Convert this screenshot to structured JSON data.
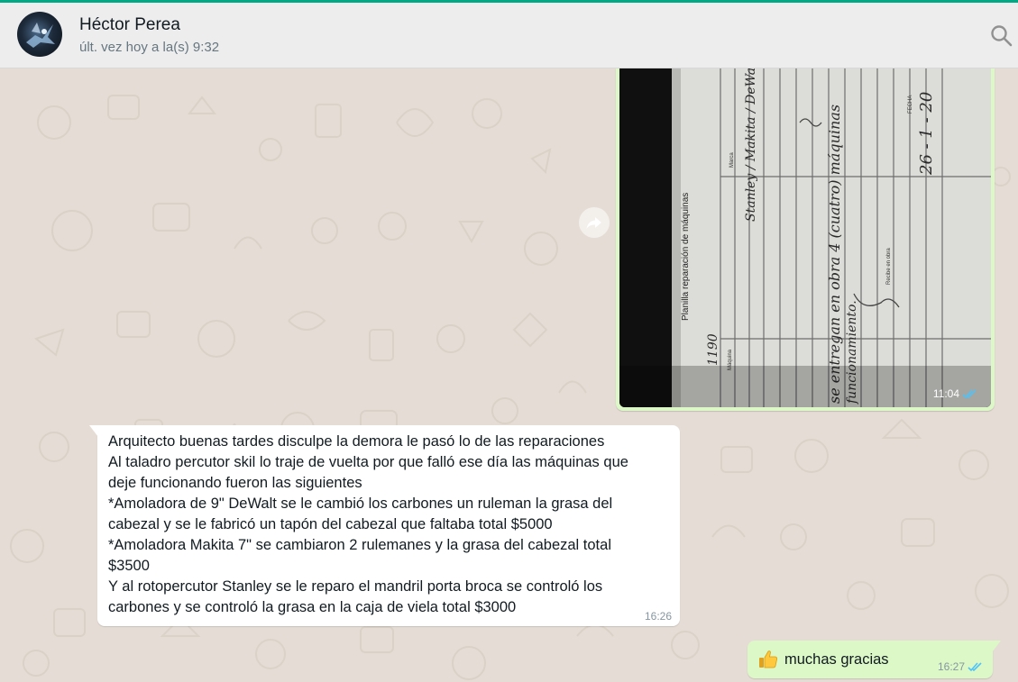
{
  "header": {
    "contact_name": "Héctor Perea",
    "last_seen": "últ. vez hoy a la(s) 9:32",
    "search_icon": "search-icon"
  },
  "messages": [
    {
      "type": "image",
      "direction": "outgoing",
      "time": "11:04",
      "read": true,
      "photo_text": {
        "title": "Planilla reparación de máquinas",
        "col_marca": "Marca",
        "col_fecha": "FECHA",
        "col_maquina": "Máquina",
        "col_recibe": "Recibe en obra",
        "hw_brands": "Stanley / Makita / DeWalt",
        "hw_date": "26 - 1 - 20",
        "hw_note": "se entregan en obra 4 (cuatro) máquinas",
        "hw_note2": "funcionamiento.",
        "hw_number": "1190"
      }
    },
    {
      "type": "text",
      "direction": "incoming",
      "time": "16:26",
      "lines": [
        "Arquitecto buenas tardes disculpe la demora le pasó lo de las reparaciones",
        "Al taladro percutor skil lo traje de vuelta por que falló ese día las máquinas que",
        "deje funcionando fueron las siguientes",
        "*Amoladora de 9\" DeWalt se le cambió los carbones un ruleman la grasa del",
        "cabezal y se le fabricó un tapón del cabezal que faltaba total $5000",
        "*Amoladora Makita 7\" se cambiaron 2 rulemanes y la grasa del cabezal total",
        "$3500",
        "Y al rotopercutor Stanley se le reparo el mandril porta broca se controló los",
        "carbones y se controló la grasa en la caja de viela total $3000"
      ]
    },
    {
      "type": "text",
      "direction": "outgoing",
      "emoji": "thumbs-up",
      "text": "muchas gracias",
      "time": "16:27",
      "read": true
    }
  ],
  "colors": {
    "chat_bg": "#e5ddd5",
    "outgoing_bubble": "#dcf8c6",
    "incoming_bubble": "#ffffff",
    "read_ticks": "#4fc3f7",
    "header_bg": "#ededed"
  }
}
